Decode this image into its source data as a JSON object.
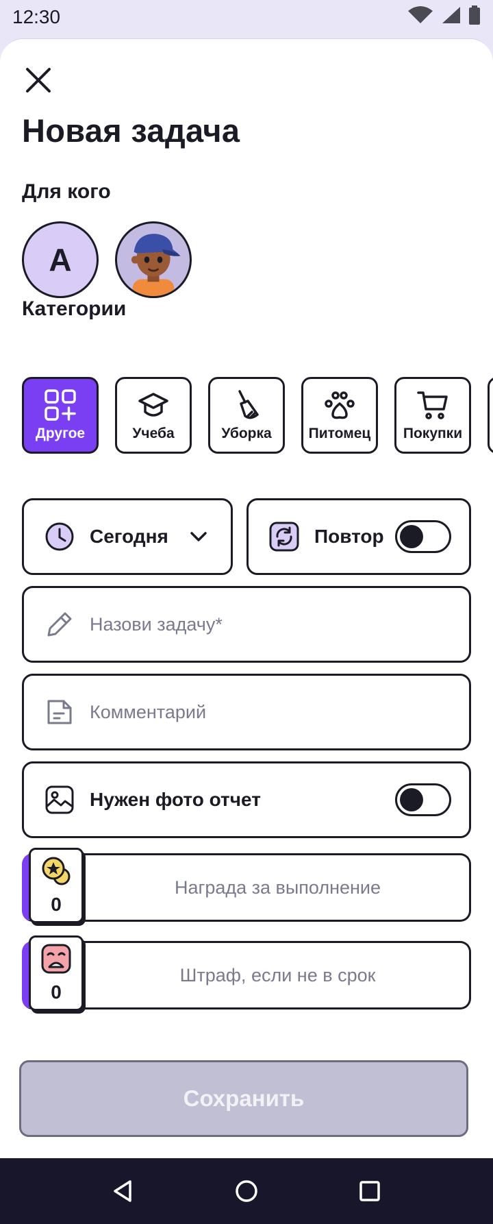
{
  "status_bar": {
    "time": "12:30",
    "icons": [
      "wifi-icon",
      "signal-icon",
      "battery-icon"
    ]
  },
  "header": {
    "close_icon": "close-icon",
    "title": "Новая задача"
  },
  "assignees": {
    "label": "Для кого",
    "items": [
      {
        "type": "letter",
        "text": "А"
      },
      {
        "type": "image",
        "icon": "kid-avatar"
      }
    ]
  },
  "categories": {
    "label": "Категории",
    "items": [
      {
        "label": "Другое",
        "icon": "grid-plus-icon",
        "active": true
      },
      {
        "label": "Учеба",
        "icon": "graduation-cap-icon",
        "active": false
      },
      {
        "label": "Уборка",
        "icon": "broom-icon",
        "active": false
      },
      {
        "label": "Питомец",
        "icon": "paw-icon",
        "active": false
      },
      {
        "label": "Покупки",
        "icon": "cart-icon",
        "active": false
      }
    ]
  },
  "date_select": {
    "value": "Сегодня",
    "icon": "clock-icon"
  },
  "repeat": {
    "label": "Повтор",
    "icon": "repeat-icon",
    "enabled": false
  },
  "task_name": {
    "placeholder": "Назови задачу*",
    "icon": "pencil-icon"
  },
  "comment": {
    "placeholder": "Комментарий",
    "icon": "note-icon"
  },
  "photo_report": {
    "label": "Нужен фото отчет",
    "icon": "image-icon",
    "enabled": false
  },
  "reward": {
    "value": "0",
    "placeholder": "Награда за выполнение",
    "icon": "coin-star-icon"
  },
  "penalty": {
    "value": "0",
    "placeholder": "Штраф, если не в срок",
    "icon": "sad-face-icon"
  },
  "save_button": {
    "label": "Сохранить"
  },
  "colors": {
    "accent": "#7a3ff2",
    "avatar_bg": "#d9cdf7",
    "disabled_button": "#c0bfd3",
    "nav_bar": "#17162a"
  }
}
